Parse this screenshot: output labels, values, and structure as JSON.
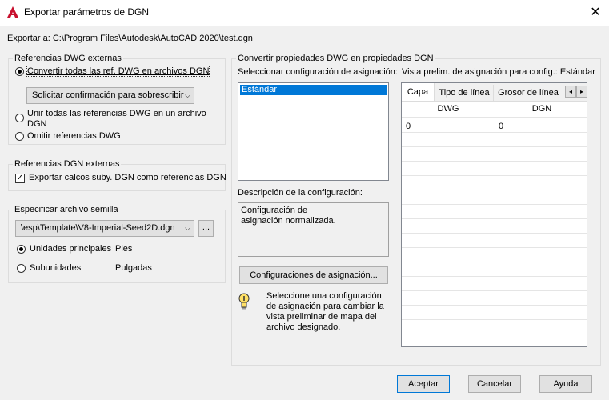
{
  "title": "Exportar parámetros de DGN",
  "export_to": "Exportar a: C:\\Program Files\\Autodesk\\AutoCAD 2020\\test.dgn",
  "dwg_refs": {
    "title": "Referencias DWG externas",
    "convert_all": "Convertir todas las ref. DWG en archivos DGN",
    "overwrite_combo": "Solicitar confirmación para sobrescribir",
    "merge_line1": "Unir todas las referencias DWG en un archivo",
    "merge_line2": "DGN",
    "omit": "Omitir referencias DWG"
  },
  "dgn_refs": {
    "title": "Referencias DGN externas",
    "export_underlays": "Exportar calcos suby. DGN como referencias DGN"
  },
  "seed": {
    "title": "Especificar archivo semilla",
    "path": "\\esp\\Template\\V8-Imperial-Seed2D.dgn",
    "browse": "...",
    "master_units": "Unidades principales",
    "master_value": "Pies",
    "sub_units": "Subunidades",
    "sub_value": "Pulgadas"
  },
  "convert": {
    "title": "Convertir propiedades DWG en propiedades DGN",
    "select_label": "Seleccionar configuración de asignación:",
    "list_items": [
      "Estándar"
    ],
    "desc_label": "Descripción de la configuración:",
    "desc_text": "Configuración de asignación normalizada.",
    "mapping_button": "Configuraciones de asignación...",
    "hint": "Seleccione una configuración de asignación para cambiar la vista preliminar de mapa del archivo designado."
  },
  "preview": {
    "label": "Vista prelim. de asignación para config.: Estándar",
    "tabs": [
      "Capa",
      "Tipo de línea",
      "Grosor de línea"
    ],
    "col_dwg": "DWG",
    "col_dgn": "DGN",
    "row_dwg": "0",
    "row_dgn": "0"
  },
  "buttons": {
    "accept": "Aceptar",
    "cancel": "Cancelar",
    "help": "Ayuda"
  }
}
